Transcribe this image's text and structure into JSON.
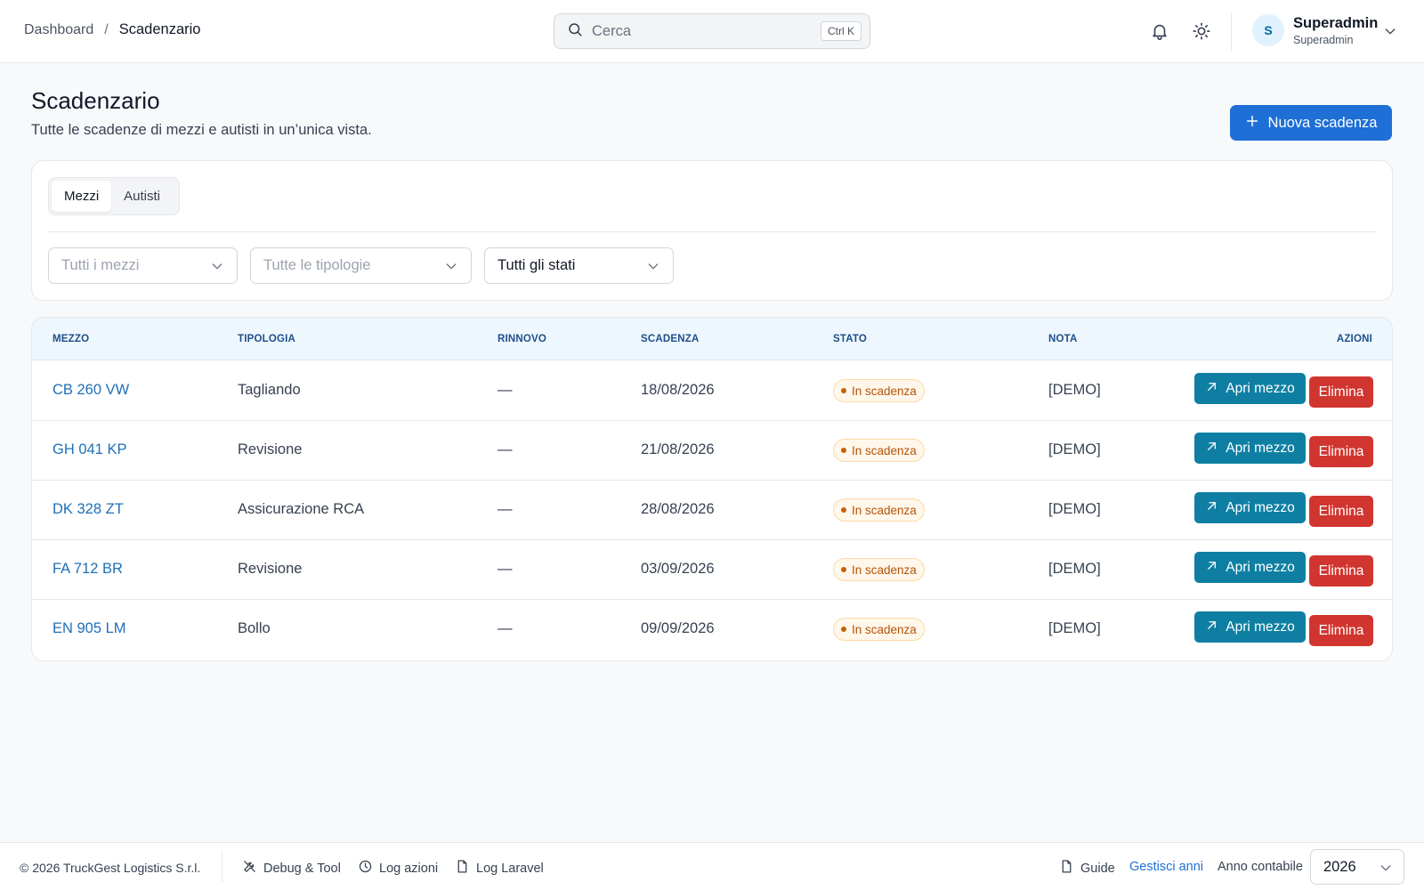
{
  "breadcrumb": {
    "parent": "Dashboard",
    "separator": "/",
    "current": "Scadenzario"
  },
  "search": {
    "placeholder": "Cerca",
    "shortcut": "Ctrl K",
    "icon": "search-icon"
  },
  "header_icons": [
    "bell-icon",
    "sun-icon"
  ],
  "user": {
    "initial": "S",
    "name": "Superadmin",
    "role": "Superadmin"
  },
  "page": {
    "title": "Scadenzario",
    "subtitle": "Tutte le scadenze di mezzi e autisti in un’unica vista.",
    "primary_button": "Nuova scadenza"
  },
  "tabs": [
    {
      "label": "Mezzi",
      "active": true
    },
    {
      "label": "Autisti",
      "active": false
    }
  ],
  "filters": {
    "mezzi_placeholder": "Tutti i mezzi",
    "tipologie_placeholder": "Tutte le tipologie",
    "stati_value": "Tutti gli stati"
  },
  "table": {
    "headers": {
      "mezzo": "MEZZO",
      "tipologia": "TIPOLOGIA",
      "rinnovo": "RINNOVO",
      "scadenza": "SCADENZA",
      "stato": "STATO",
      "nota": "NOTA",
      "azioni": "AZIONI"
    },
    "open_label": "Apri mezzo",
    "delete_label": "Elimina",
    "rows": [
      {
        "mezzo": "CB 260 VW",
        "tipologia": "Tagliando",
        "rinnovo": "—",
        "scadenza": "18/08/2026",
        "stato": "In scadenza",
        "nota": "[DEMO]"
      },
      {
        "mezzo": "GH 041 KP",
        "tipologia": "Revisione",
        "rinnovo": "—",
        "scadenza": "21/08/2026",
        "stato": "In scadenza",
        "nota": "[DEMO]"
      },
      {
        "mezzo": "DK 328 ZT",
        "tipologia": "Assicurazione RCA",
        "rinnovo": "—",
        "scadenza": "28/08/2026",
        "stato": "In scadenza",
        "nota": "[DEMO]"
      },
      {
        "mezzo": "FA 712 BR",
        "tipologia": "Revisione",
        "rinnovo": "—",
        "scadenza": "03/09/2026",
        "stato": "In scadenza",
        "nota": "[DEMO]"
      },
      {
        "mezzo": "EN 905 LM",
        "tipologia": "Bollo",
        "rinnovo": "—",
        "scadenza": "09/09/2026",
        "stato": "In scadenza",
        "nota": "[DEMO]"
      }
    ]
  },
  "colors": {
    "primary": "#1e6fd6",
    "open_button": "#0e7fa3",
    "delete_button": "#d1352f",
    "badge_text": "#b45309",
    "link": "#1f6fb8"
  },
  "footer": {
    "copyright": "© 2026 TruckGest Logistics S.r.l.",
    "debug": "Debug & Tool",
    "log_azioni": "Log azioni",
    "log_laravel": "Log Laravel",
    "guide": "Guide",
    "gestisci_anni": "Gestisci anni",
    "anno_label": "Anno contabile",
    "anno_value": "2026"
  }
}
